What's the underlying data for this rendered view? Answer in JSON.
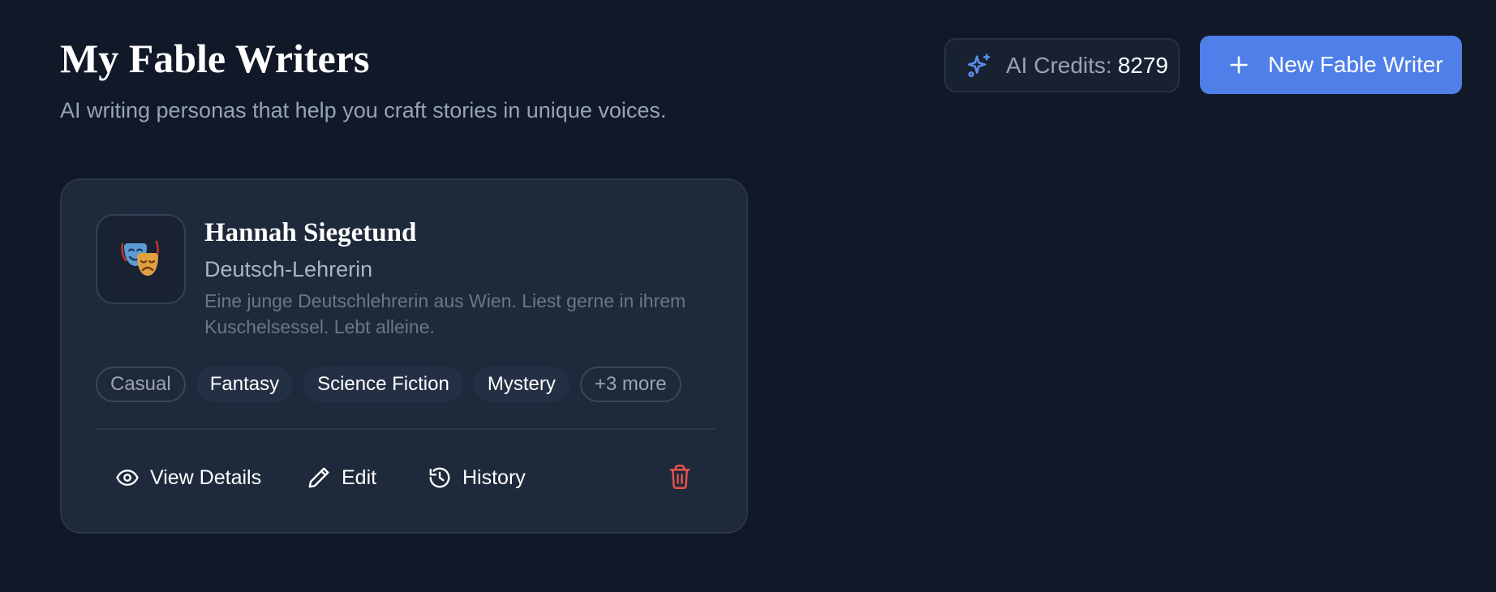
{
  "header": {
    "title": "My Fable Writers",
    "subtitle": "AI writing personas that help you craft stories in unique voices.",
    "credits_label": "AI Credits:",
    "credits_value": "8279",
    "new_button_label": "New Fable Writer"
  },
  "card": {
    "avatar_icon": "theater-masks-icon",
    "name": "Hannah Siegetund",
    "role": "Deutsch-Lehrerin",
    "description": "Eine junge Deutschlehrerin aus Wien. Liest gerne in ihrem Kuschelsessel. Lebt alleine.",
    "tags": [
      "Casual",
      "Fantasy",
      "Science Fiction",
      "Mystery",
      "+3 more"
    ],
    "actions": {
      "view": "View Details",
      "edit": "Edit",
      "history": "History"
    }
  },
  "colors": {
    "background": "#111827",
    "card": "#1e293b",
    "accent": "#4f7fe8",
    "danger": "#e5534b"
  }
}
